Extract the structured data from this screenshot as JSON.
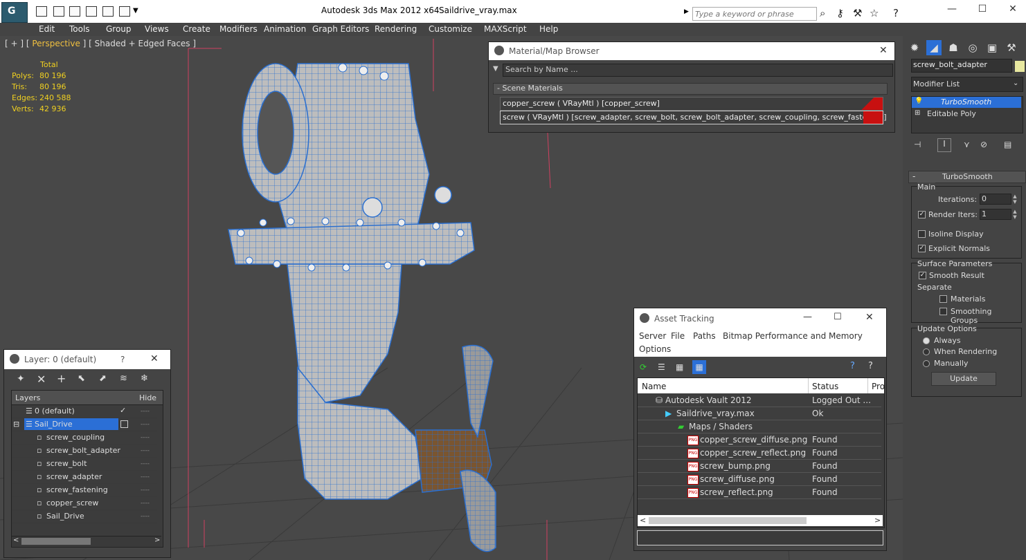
{
  "titlebar": {
    "app_title": "Autodesk 3ds Max  2012 x64",
    "file_title": "Saildrive_vray.max",
    "search_placeholder": "Type a keyword or phrase",
    "logo_text": "G"
  },
  "menubar": [
    "Edit",
    "Tools",
    "Group",
    "Views",
    "Create",
    "Modifiers",
    "Animation",
    "Graph Editors",
    "Rendering",
    "Customize",
    "MAXScript",
    "Help"
  ],
  "viewport": {
    "label_prefix": "[ + ] [ ",
    "label_view": "Perspective",
    "label_suffix": " ] [ Shaded + Edged Faces ]",
    "stats_header": "Total",
    "stats": [
      {
        "label": "Polys:",
        "value": "80 196"
      },
      {
        "label": "Tris:",
        "value": "80 196"
      },
      {
        "label": "Edges:",
        "value": "240 588"
      },
      {
        "label": "Verts:",
        "value": "42 936"
      }
    ]
  },
  "material_browser": {
    "title": "Material/Map Browser",
    "search_placeholder": "Search by Name ...",
    "section": "- Scene Materials",
    "materials": [
      "copper_screw  ( VRayMtl ) [copper_screw]",
      "screw ( VRayMtl ) [screw_adapter, screw_bolt, screw_bolt_adapter, screw_coupling, screw_fastening]"
    ]
  },
  "command_panel": {
    "object_name": "screw_bolt_adapter",
    "modifier_list": "Modifier List",
    "stack": [
      "TurboSmooth",
      "Editable Poly"
    ],
    "rollout_title": "TurboSmooth",
    "main_group": "Main",
    "iterations_label": "Iterations:",
    "iterations_value": "0",
    "render_iters_label": "Render Iters:",
    "render_iters_value": "1",
    "render_iters_checked": true,
    "isoline_label": "Isoline Display",
    "isoline_checked": false,
    "explicit_label": "Explicit Normals",
    "explicit_checked": true,
    "surface_group": "Surface Parameters",
    "smooth_result_label": "Smooth Result",
    "smooth_result_checked": true,
    "separate_label": "Separate",
    "materials_label": "Materials",
    "smoothing_groups_label": "Smoothing Groups",
    "update_group": "Update Options",
    "update_options": [
      "Always",
      "When Rendering",
      "Manually"
    ],
    "update_selected": "Always",
    "update_button": "Update"
  },
  "layer_dialog": {
    "title": "Layer: 0 (default)",
    "help": "?",
    "col_layers": "Layers",
    "col_hide": "Hide",
    "rows": [
      {
        "name": "0 (default)",
        "indent": 1,
        "checked": true
      },
      {
        "name": "Sail_Drive",
        "indent": 1,
        "selected": true
      },
      {
        "name": "screw_coupling",
        "indent": 2
      },
      {
        "name": "screw_bolt_adapter",
        "indent": 2
      },
      {
        "name": "screw_bolt",
        "indent": 2
      },
      {
        "name": "screw_adapter",
        "indent": 2
      },
      {
        "name": "screw_fastening",
        "indent": 2
      },
      {
        "name": "copper_screw",
        "indent": 2
      },
      {
        "name": "Sail_Drive",
        "indent": 2
      }
    ],
    "hide_marker": "----"
  },
  "asset_tracking": {
    "title": "Asset Tracking",
    "menu": [
      "Server",
      "File",
      "Paths",
      "Bitmap Performance and Memory",
      "Options"
    ],
    "col_name": "Name",
    "col_status": "Status",
    "col_pro": "Pro",
    "png_tag": "PNG",
    "rows": [
      {
        "name": "Autodesk Vault 2012",
        "status": "Logged Out ...",
        "indent": 0,
        "kind": "vault"
      },
      {
        "name": "Saildrive_vray.max",
        "status": "Ok",
        "indent": 1,
        "kind": "max"
      },
      {
        "name": "Maps / Shaders",
        "status": "",
        "indent": 2,
        "kind": "folder"
      },
      {
        "name": "copper_screw_diffuse.png",
        "status": "Found",
        "indent": 3,
        "kind": "png"
      },
      {
        "name": "copper_screw_reflect.png",
        "status": "Found",
        "indent": 3,
        "kind": "png"
      },
      {
        "name": "screw_bump.png",
        "status": "Found",
        "indent": 3,
        "kind": "png"
      },
      {
        "name": "screw_diffuse.png",
        "status": "Found",
        "indent": 3,
        "kind": "png"
      },
      {
        "name": "screw_reflect.png",
        "status": "Found",
        "indent": 3,
        "kind": "png"
      }
    ]
  },
  "colors": {
    "wire_blue": "#2a6fd0",
    "mesh_grey": "#bdbdbd",
    "copper": "#7a5530",
    "selection_blue": "#2b6fd6",
    "stat_yellow": "#f0d020"
  }
}
